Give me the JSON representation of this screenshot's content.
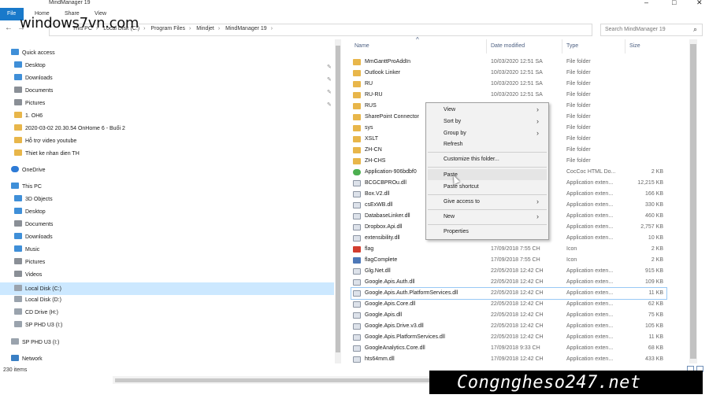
{
  "window": {
    "title": "MindManager 19",
    "minimize": "–",
    "maximize": "□",
    "close": "✕"
  },
  "ribbon": {
    "tabs": [
      "File",
      "Home",
      "Share",
      "View"
    ]
  },
  "watermark": {
    "logo": "windows7vn.com",
    "banner": "Congngheso247.net"
  },
  "navigation": {
    "back": "←",
    "forward": "→",
    "breadcrumb": [
      "This PC",
      "Local Disk (C:)",
      "Program Files",
      "Mindjet",
      "MindManager 19"
    ],
    "search_placeholder": "Search MindManager 19"
  },
  "sidebar": {
    "items": [
      {
        "label": "Quick access",
        "icon": "star-icon"
      },
      {
        "label": "Desktop",
        "icon": "desktop-icon"
      },
      {
        "label": "Downloads",
        "icon": "downloads-icon"
      },
      {
        "label": "Documents",
        "icon": "documents-icon"
      },
      {
        "label": "Pictures",
        "icon": "pictures-icon"
      },
      {
        "label": "1. OH6",
        "icon": "folder-icon"
      },
      {
        "label": "2020-03-02 20.30.54 OnHome 6 - Buổi 2",
        "icon": "folder-icon"
      },
      {
        "label": "Hỗ trợ video youtube",
        "icon": "folder-icon"
      },
      {
        "label": "Thiet ke nhan dien TH",
        "icon": "folder-icon"
      },
      {
        "label": "OneDrive",
        "icon": "cloud-icon"
      },
      {
        "label": "This PC",
        "icon": "computer-icon"
      },
      {
        "label": "3D Objects",
        "icon": "cube-icon"
      },
      {
        "label": "Desktop",
        "icon": "desktop-icon"
      },
      {
        "label": "Documents",
        "icon": "documents-icon"
      },
      {
        "label": "Downloads",
        "icon": "downloads-icon"
      },
      {
        "label": "Music",
        "icon": "music-icon"
      },
      {
        "label": "Pictures",
        "icon": "pictures-icon"
      },
      {
        "label": "Videos",
        "icon": "videos-icon"
      },
      {
        "label": "Local Disk (C:)",
        "icon": "drive-icon"
      },
      {
        "label": "Local Disk (D:)",
        "icon": "drive-icon"
      },
      {
        "label": "CD Drive (H:)",
        "icon": "cd-drive-icon"
      },
      {
        "label": "SP PHD U3 (I:)",
        "icon": "usb-drive-icon"
      },
      {
        "label": "SP PHD U3 (I:)",
        "icon": "usb-drive-icon"
      },
      {
        "label": "Network",
        "icon": "network-icon"
      }
    ]
  },
  "columns": {
    "name": "Name",
    "date": "Date modified",
    "type": "Type",
    "size": "Size"
  },
  "files": [
    {
      "name": "MmGanttProAddIn",
      "date": "10/03/2020 12:51 SA",
      "type": "File folder",
      "size": ""
    },
    {
      "name": "Outlook Linker",
      "date": "10/03/2020 12:51 SA",
      "type": "File folder",
      "size": ""
    },
    {
      "name": "RU",
      "date": "10/03/2020 12:51 SA",
      "type": "File folder",
      "size": ""
    },
    {
      "name": "RU-RU",
      "date": "10/03/2020 12:51 SA",
      "type": "File folder",
      "size": ""
    },
    {
      "name": "RUS",
      "date": "",
      "type": "File folder",
      "size": ""
    },
    {
      "name": "SharePoint Connector",
      "date": "",
      "type": "File folder",
      "size": ""
    },
    {
      "name": "sys",
      "date": "",
      "type": "File folder",
      "size": ""
    },
    {
      "name": "XSLT",
      "date": "",
      "type": "File folder",
      "size": ""
    },
    {
      "name": "ZH-CN",
      "date": "",
      "type": "File folder",
      "size": ""
    },
    {
      "name": "ZH-CHS",
      "date": "",
      "type": "File folder",
      "size": ""
    },
    {
      "name": "Application-906bdbf0",
      "date": "",
      "type": "CocCoc HTML Do...",
      "size": "2 KB"
    },
    {
      "name": "BCGCBPROu.dll",
      "date": "",
      "type": "Application exten...",
      "size": "12,215 KB"
    },
    {
      "name": "Box.V2.dll",
      "date": "",
      "type": "Application exten...",
      "size": "166 KB"
    },
    {
      "name": "csExWB.dll",
      "date": "",
      "type": "Application exten...",
      "size": "330 KB"
    },
    {
      "name": "DatabaseLinker.dll",
      "date": "",
      "type": "Application exten...",
      "size": "460 KB"
    },
    {
      "name": "Dropbox.Api.dll",
      "date": "",
      "type": "Application exten...",
      "size": "2,757 KB"
    },
    {
      "name": "extensibility.dll",
      "date": "",
      "type": "Application exten...",
      "size": "10 KB"
    },
    {
      "name": "flag",
      "date": "17/09/2018 7:55 CH",
      "type": "Icon",
      "size": "2 KB"
    },
    {
      "name": "flagComplete",
      "date": "17/09/2018 7:55 CH",
      "type": "Icon",
      "size": "2 KB"
    },
    {
      "name": "Glg.Net.dll",
      "date": "22/05/2018 12:42 CH",
      "type": "Application exten...",
      "size": "915 KB"
    },
    {
      "name": "Google.Apis.Auth.dll",
      "date": "22/05/2018 12:42 CH",
      "type": "Application exten...",
      "size": "109 KB"
    },
    {
      "name": "Google.Apis.Auth.PlatformServices.dll",
      "date": "22/05/2018 12:42 CH",
      "type": "Application exten...",
      "size": "11 KB"
    },
    {
      "name": "Google.Apis.Core.dll",
      "date": "22/05/2018 12:42 CH",
      "type": "Application exten...",
      "size": "62 KB"
    },
    {
      "name": "Google.Apis.dll",
      "date": "22/05/2018 12:42 CH",
      "type": "Application exten...",
      "size": "75 KB"
    },
    {
      "name": "Google.Apis.Drive.v3.dll",
      "date": "22/05/2018 12:42 CH",
      "type": "Application exten...",
      "size": "105 KB"
    },
    {
      "name": "Google.Apis.PlatformServices.dll",
      "date": "22/05/2018 12:42 CH",
      "type": "Application exten...",
      "size": "11 KB"
    },
    {
      "name": "GoogleAnalytics.Core.dll",
      "date": "17/09/2018 9:33 CH",
      "type": "Application exten...",
      "size": "68 KB"
    },
    {
      "name": "hts64mm.dll",
      "date": "17/09/2018 12:42 CH",
      "type": "Application exten...",
      "size": "433 KB"
    }
  ],
  "context_menu": {
    "items": [
      {
        "label": "View",
        "submenu": true
      },
      {
        "label": "Sort by",
        "submenu": true
      },
      {
        "label": "Group by",
        "submenu": true
      },
      {
        "label": "Refresh",
        "submenu": false
      },
      {
        "label": "Customize this folder...",
        "submenu": false
      },
      {
        "label": "Paste",
        "submenu": false
      },
      {
        "label": "Paste shortcut",
        "submenu": false
      },
      {
        "label": "Give access to",
        "submenu": true
      },
      {
        "label": "New",
        "submenu": true
      },
      {
        "label": "Properties",
        "submenu": false
      }
    ]
  },
  "status": {
    "item_count": "230 items"
  },
  "colors": {
    "accent": "#1979ca",
    "selection": "#cce8ff",
    "folder": "#e8b64a"
  }
}
